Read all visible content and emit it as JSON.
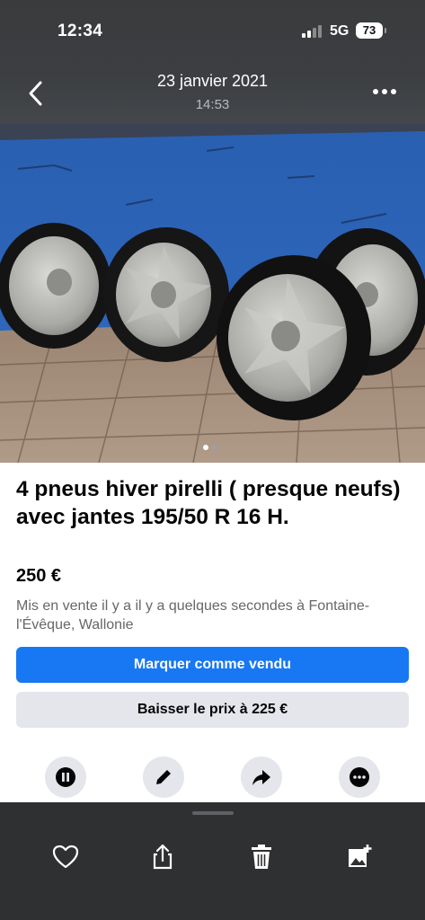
{
  "status_bar": {
    "time": "12:34",
    "network": "5G",
    "battery": "73"
  },
  "nav": {
    "date": "23 janvier 2021",
    "time": "14:53",
    "back_icon": "chevron-left-icon",
    "more_icon": "more-horizontal-icon"
  },
  "photo": {
    "page_count": 2,
    "current_page": 1
  },
  "listing": {
    "title": "4 pneus hiver pirelli ( presque neufs) avec jantes 195/50  R  16 H.",
    "price": "250 €",
    "meta": "Mis en vente il y a il y a quelques secondes à Fontaine-l'Évêque, Wallonie",
    "primary_button": "Marquer comme vendu",
    "secondary_button": "Baisser le prix à 225 €"
  },
  "actions": [
    "pause-icon",
    "pencil-icon",
    "share-arrow-icon",
    "more-icon"
  ],
  "toolbar": [
    "heart-icon",
    "share-icon",
    "trash-icon",
    "add-photo-icon"
  ],
  "colors": {
    "accent": "#1877f2",
    "secondary_button_bg": "#e4e6eb",
    "muted_text": "#65676b",
    "dark_bg": "#2f3032"
  }
}
